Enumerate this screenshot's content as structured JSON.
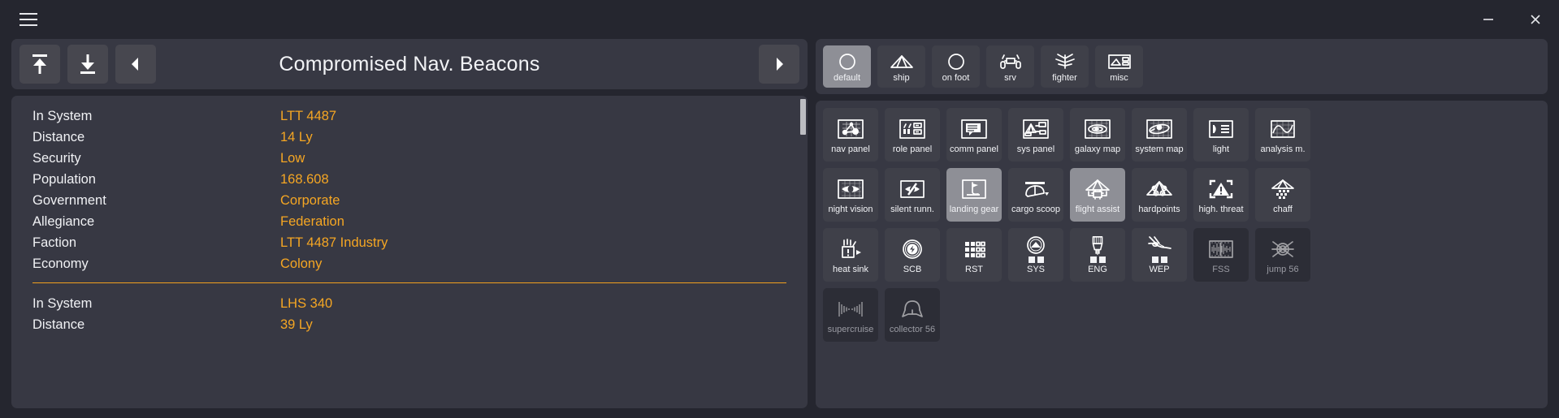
{
  "window": {
    "menu_icon": "hamburger-icon",
    "minimize_label": "minimize-icon",
    "close_label": "close-icon"
  },
  "toolbar": {
    "title": "Compromised Nav. Beacons",
    "first_button": "jump-to-top",
    "last_button": "jump-to-bottom",
    "prev_button": "previous",
    "next_button": "next"
  },
  "list": {
    "groups": [
      {
        "rows": [
          {
            "key": "In System",
            "value": "LTT 4487"
          },
          {
            "key": "Distance",
            "value": "14 Ly"
          },
          {
            "key": "Security",
            "value": "Low"
          },
          {
            "key": "Population",
            "value": "168.608"
          },
          {
            "key": "Government",
            "value": "Corporate"
          },
          {
            "key": "Allegiance",
            "value": "Federation"
          },
          {
            "key": "Faction",
            "value": "LTT 4487 Industry"
          },
          {
            "key": "Economy",
            "value": "Colony"
          }
        ]
      },
      {
        "rows": [
          {
            "key": "In System",
            "value": "LHS 340"
          },
          {
            "key": "Distance",
            "value": "39 Ly"
          }
        ]
      }
    ]
  },
  "tabs": [
    {
      "label": "default",
      "icon": "circle-icon",
      "selected": true
    },
    {
      "label": "ship",
      "icon": "ship-icon",
      "selected": false
    },
    {
      "label": "on foot",
      "icon": "circle-icon",
      "selected": false
    },
    {
      "label": "srv",
      "icon": "srv-icon",
      "selected": false
    },
    {
      "label": "fighter",
      "icon": "fighter-icon",
      "selected": false
    },
    {
      "label": "misc",
      "icon": "misc-panel-icon",
      "selected": false
    }
  ],
  "grid": [
    {
      "label": "nav panel",
      "icon": "nav-panel-icon",
      "state": "normal"
    },
    {
      "label": "role panel",
      "icon": "role-panel-icon",
      "state": "normal"
    },
    {
      "label": "comm panel",
      "icon": "comm-panel-icon",
      "state": "normal"
    },
    {
      "label": "sys panel",
      "icon": "sys-panel-icon",
      "state": "normal"
    },
    {
      "label": "galaxy map",
      "icon": "galaxy-map-icon",
      "state": "normal"
    },
    {
      "label": "system map",
      "icon": "system-map-icon",
      "state": "normal"
    },
    {
      "label": "light",
      "icon": "light-icon",
      "state": "normal"
    },
    {
      "label": "analysis m.",
      "icon": "analysis-mode-icon",
      "state": "normal"
    },
    {
      "label": "night vision",
      "icon": "night-vision-icon",
      "state": "normal"
    },
    {
      "label": "silent runn.",
      "icon": "silent-running-icon",
      "state": "normal"
    },
    {
      "label": "landing gear",
      "icon": "landing-gear-icon",
      "state": "highlighted"
    },
    {
      "label": "cargo scoop",
      "icon": "cargo-scoop-icon",
      "state": "normal"
    },
    {
      "label": "flight assist",
      "icon": "flight-assist-icon",
      "state": "highlighted"
    },
    {
      "label": "hardpoints",
      "icon": "hardpoints-icon",
      "state": "normal"
    },
    {
      "label": "high. threat",
      "icon": "high-threat-icon",
      "state": "normal"
    },
    {
      "label": "chaff",
      "icon": "chaff-icon",
      "state": "normal"
    },
    {
      "label": "heat sink",
      "icon": "heat-sink-icon",
      "state": "normal"
    },
    {
      "label": "SCB",
      "icon": "shield-cell-icon",
      "state": "normal"
    },
    {
      "label": "RST",
      "icon": "reset-pips-icon",
      "state": "normal"
    },
    {
      "label": "SYS",
      "icon": "systems-pips-icon",
      "state": "normal",
      "pips": 2
    },
    {
      "label": "ENG",
      "icon": "engines-pips-icon",
      "state": "normal",
      "pips": 2
    },
    {
      "label": "WEP",
      "icon": "weapons-pips-icon",
      "state": "normal",
      "pips": 2
    },
    {
      "label": "FSS",
      "icon": "fss-icon",
      "state": "dimmed"
    },
    {
      "label": "jump 56",
      "icon": "jump-icon",
      "state": "dimmed"
    },
    {
      "label": "supercruise",
      "icon": "supercruise-icon",
      "state": "dimmed"
    },
    {
      "label": "collector 56",
      "icon": "collector-limpet-icon",
      "state": "dimmed"
    }
  ],
  "colors": {
    "accent": "#f5a623",
    "divider": "#f0a01e",
    "panel": "#373843",
    "cell": "#3f4049",
    "cell_highlight": "#8e8f96",
    "cell_dim": "#2c2d36",
    "window_bg": "#25262f",
    "text": "#f0f1f4"
  }
}
